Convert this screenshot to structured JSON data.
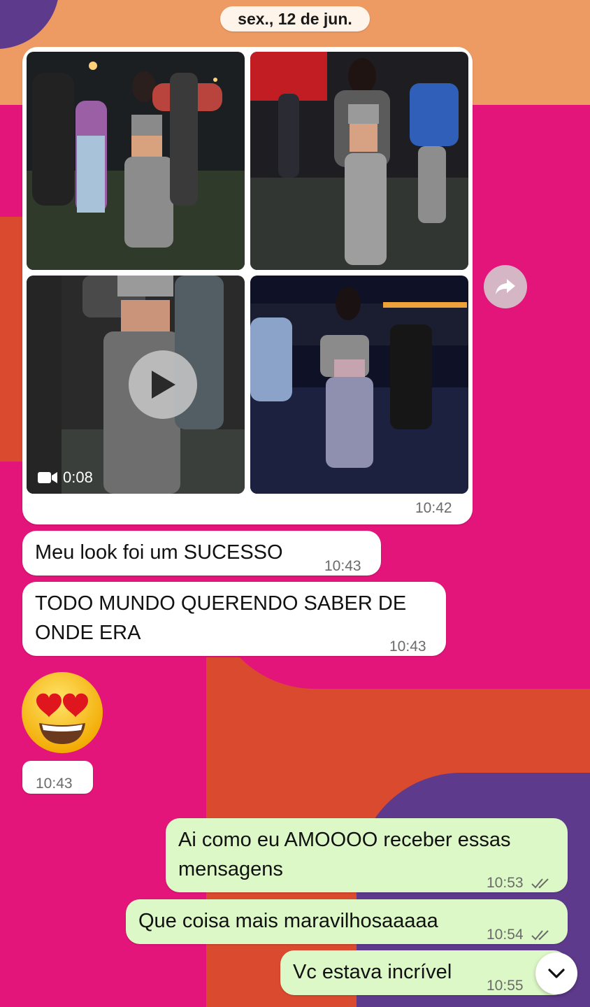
{
  "date_divider": "sex., 12 de jun.",
  "album": {
    "time": "10:42",
    "video_duration": "0:08"
  },
  "messages": [
    {
      "text": "Meu look foi um SUCESSO",
      "time": "10:43",
      "direction": "in"
    },
    {
      "text": "TODO MUNDO QUERENDO SABER DE ONDE ERA",
      "time": "10:43",
      "direction": "in"
    },
    {
      "text": "",
      "time": "10:43",
      "direction": "in",
      "emoji": "heart-eyes-emoji"
    },
    {
      "text": "Ai como eu AMOOOO receber essas mensagens",
      "time": "10:53",
      "direction": "out"
    },
    {
      "text": "Que coisa mais maravilhosaaaaa",
      "time": "10:54",
      "direction": "out"
    },
    {
      "text": "Vc estava incrível",
      "time": "10:55",
      "direction": "out"
    }
  ],
  "icons": {
    "forward": "forward-arrow-icon",
    "play": "play-icon",
    "video": "video-camera-icon",
    "scroll_down": "chevron-down-icon",
    "read": "double-check-icon"
  },
  "colors": {
    "incoming_bubble": "#FFFFFF",
    "outgoing_bubble": "#DCF8C6",
    "background_pink": "#E4157A",
    "background_orange": "#D94A2E",
    "background_purple": "#5E3A8C",
    "background_peach": "#EE9A63"
  }
}
